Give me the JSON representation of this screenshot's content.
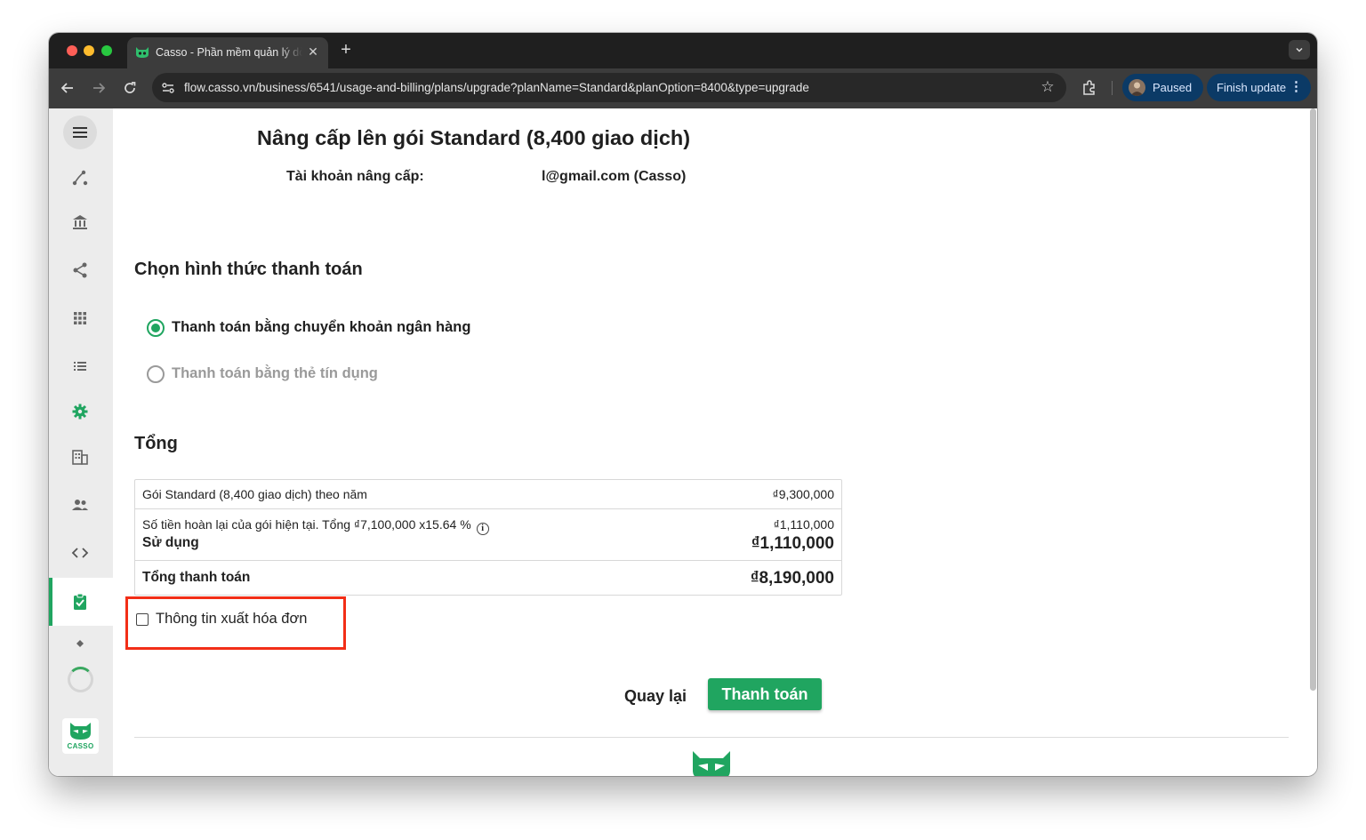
{
  "browser": {
    "tab": {
      "title": "Casso - Phần mềm quản lý dòng tiền",
      "close_glyph": "✕"
    },
    "new_tab_glyph": "+",
    "url": "flow.casso.vn/business/6541/usage-and-billing/plans/upgrade?planName=Standard&planOption=8400&type=upgrade",
    "profile_status": "Paused",
    "update_button": "Finish update"
  },
  "page": {
    "title": "Nâng cấp lên gói Standard (8,400 giao dịch)",
    "account_label": "Tài khoản nâng cấp:",
    "account_value": "l@gmail.com (Casso)",
    "payment_section_title": "Chọn hình thức thanh toán",
    "payment_options": [
      {
        "label": "Thanh toán bằng chuyển khoản ngân hàng",
        "selected": true,
        "enabled": true
      },
      {
        "label": "Thanh toán bằng thẻ tín dụng",
        "selected": false,
        "enabled": false
      }
    ],
    "total_section_title": "Tổng",
    "totals": {
      "plan_label": "Gói Standard (8,400 giao dịch) theo năm",
      "plan_amount": "₫9,300,000",
      "refund_label": "Số tiền hoàn lại của gói hiện tại. Tổng ₫7,100,000 x15.64 %",
      "refund_amount": "₫1,110,000",
      "used_label": "Sử dụng",
      "used_amount": "₫1,110,000",
      "grand_total_label": "Tổng thanh toán",
      "grand_total_amount": "₫8,190,000"
    },
    "invoice_checkbox_label": "Thông tin xuất hóa đơn",
    "invoice_checked": false,
    "back_button": "Quay lại",
    "pay_button": "Thanh toán"
  },
  "sidebar": {
    "logo_text": "CASSO",
    "items": [
      "menu",
      "flow",
      "bank",
      "share",
      "apps",
      "list",
      "settings",
      "business",
      "users",
      "developer",
      "billing",
      "more"
    ],
    "active_item": "billing"
  },
  "colors": {
    "brand_green": "#20a560",
    "highlight_red": "#f22e17",
    "browser_dark": "#1f1f1f",
    "toolbar": "#3c3c3c",
    "pill_blue": "#0b3a66"
  }
}
